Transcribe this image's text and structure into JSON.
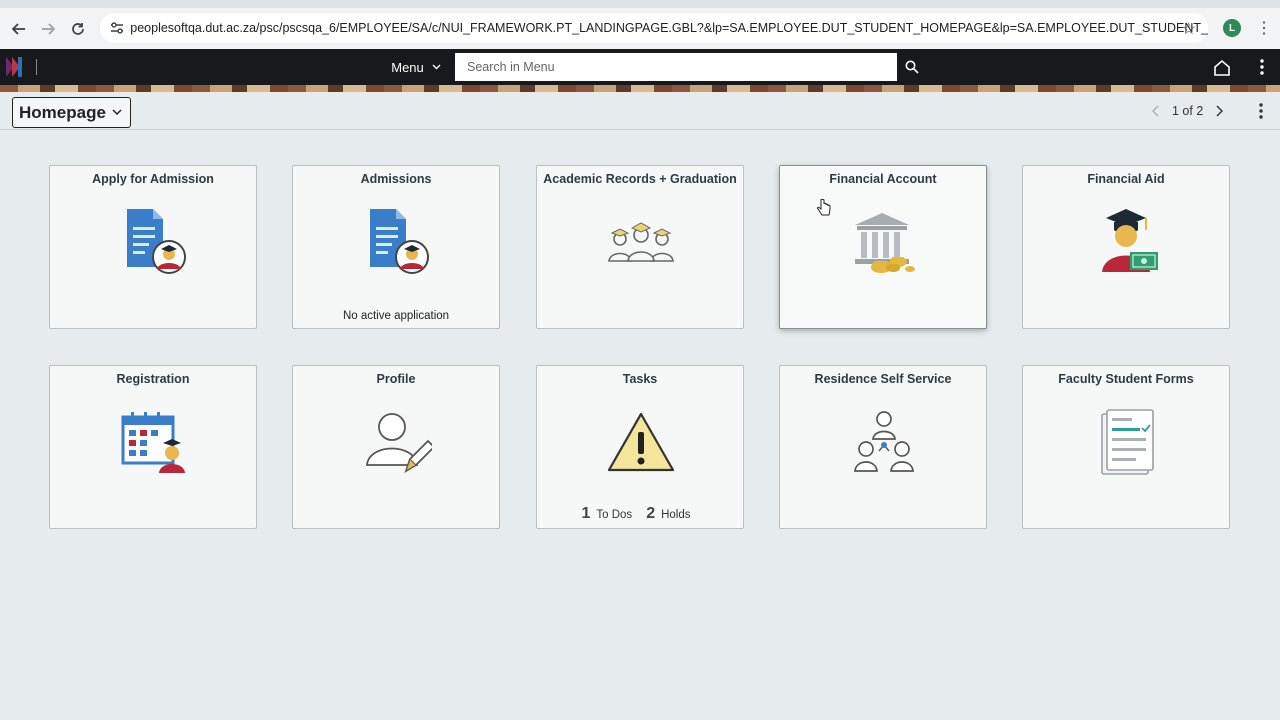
{
  "browser": {
    "url": "peoplesoftqa.dut.ac.za/psc/pscsqa_6/EMPLOYEE/SA/c/NUI_FRAMEWORK.PT_LANDINGPAGE.GBL?&lp=SA.EMPLOYEE.DUT_STUDENT_HOMEPAGE&lp=SA.EMPLOYEE.DUT_STUDENT_HOMEPAGE",
    "profile_initial": "L",
    "icons": [
      "back-arrow-icon",
      "forward-arrow-icon",
      "reload-icon",
      "site-settings-icon",
      "bookmark-star-icon",
      "more-vertical-icon"
    ]
  },
  "header": {
    "menu_label": "Menu",
    "search_placeholder": "Search in Menu",
    "icons": [
      "search-icon",
      "home-icon",
      "more-vertical-icon"
    ]
  },
  "titlebar": {
    "homepage_label": "Homepage",
    "pager": "1 of 2"
  },
  "tiles": [
    {
      "title": "Apply for Admission",
      "icon": "document-student-icon",
      "footer": ""
    },
    {
      "title": "Admissions",
      "icon": "document-student-icon",
      "footer": "No active application"
    },
    {
      "title": "Academic Records + Graduation",
      "icon": "graduates-group-icon",
      "footer": ""
    },
    {
      "title": "Financial Account",
      "icon": "bank-money-bag-icon",
      "footer": ""
    },
    {
      "title": "Financial Aid",
      "icon": "graduate-cash-icon",
      "footer": ""
    },
    {
      "title": "Registration",
      "icon": "calendar-student-icon",
      "footer": ""
    },
    {
      "title": "Profile",
      "icon": "person-edit-icon",
      "footer": ""
    },
    {
      "title": "Tasks",
      "icon": "warning-triangle-icon",
      "footer": ""
    },
    {
      "title": "Residence Self Service",
      "icon": "people-network-icon",
      "footer": ""
    },
    {
      "title": "Faculty Student Forms",
      "icon": "checklist-form-icon",
      "footer": ""
    }
  ],
  "tasks": {
    "todos_count": "1",
    "todos_label": "To Dos",
    "holds_count": "2",
    "holds_label": "Holds"
  },
  "colors": {
    "header_bg": "#161a1c",
    "page_bg": "#e6ecee",
    "tile_bg": "#f6f7f7",
    "tile_title": "#2e3b44",
    "doc_blue": "#3a7dc9",
    "warning_yellow": "#f3e59a"
  }
}
